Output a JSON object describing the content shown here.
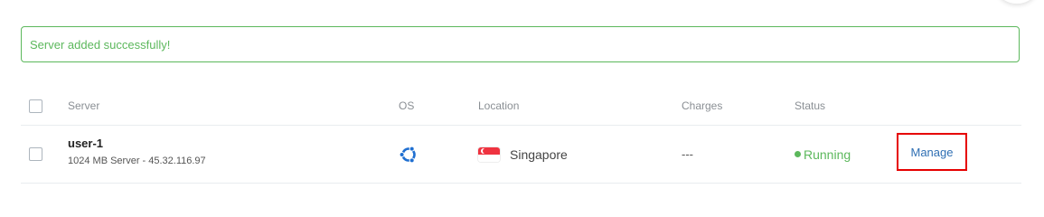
{
  "alert": {
    "message": "Server added successfully!"
  },
  "table": {
    "headers": {
      "server": "Server",
      "os": "OS",
      "location": "Location",
      "charges": "Charges",
      "status": "Status"
    },
    "rows": [
      {
        "name": "user-1",
        "description": "1024 MB Server - 45.32.116.97",
        "os_icon": "ubuntu-icon",
        "location": "Singapore",
        "flag_icon": "singapore-flag-icon",
        "charges": "---",
        "status": "Running",
        "action_label": "Manage"
      }
    ]
  },
  "colors": {
    "success": "#5cb85c",
    "link": "#2f6fb3",
    "highlight_border": "#e60000",
    "ubuntu_icon": "#1f6fd1"
  }
}
